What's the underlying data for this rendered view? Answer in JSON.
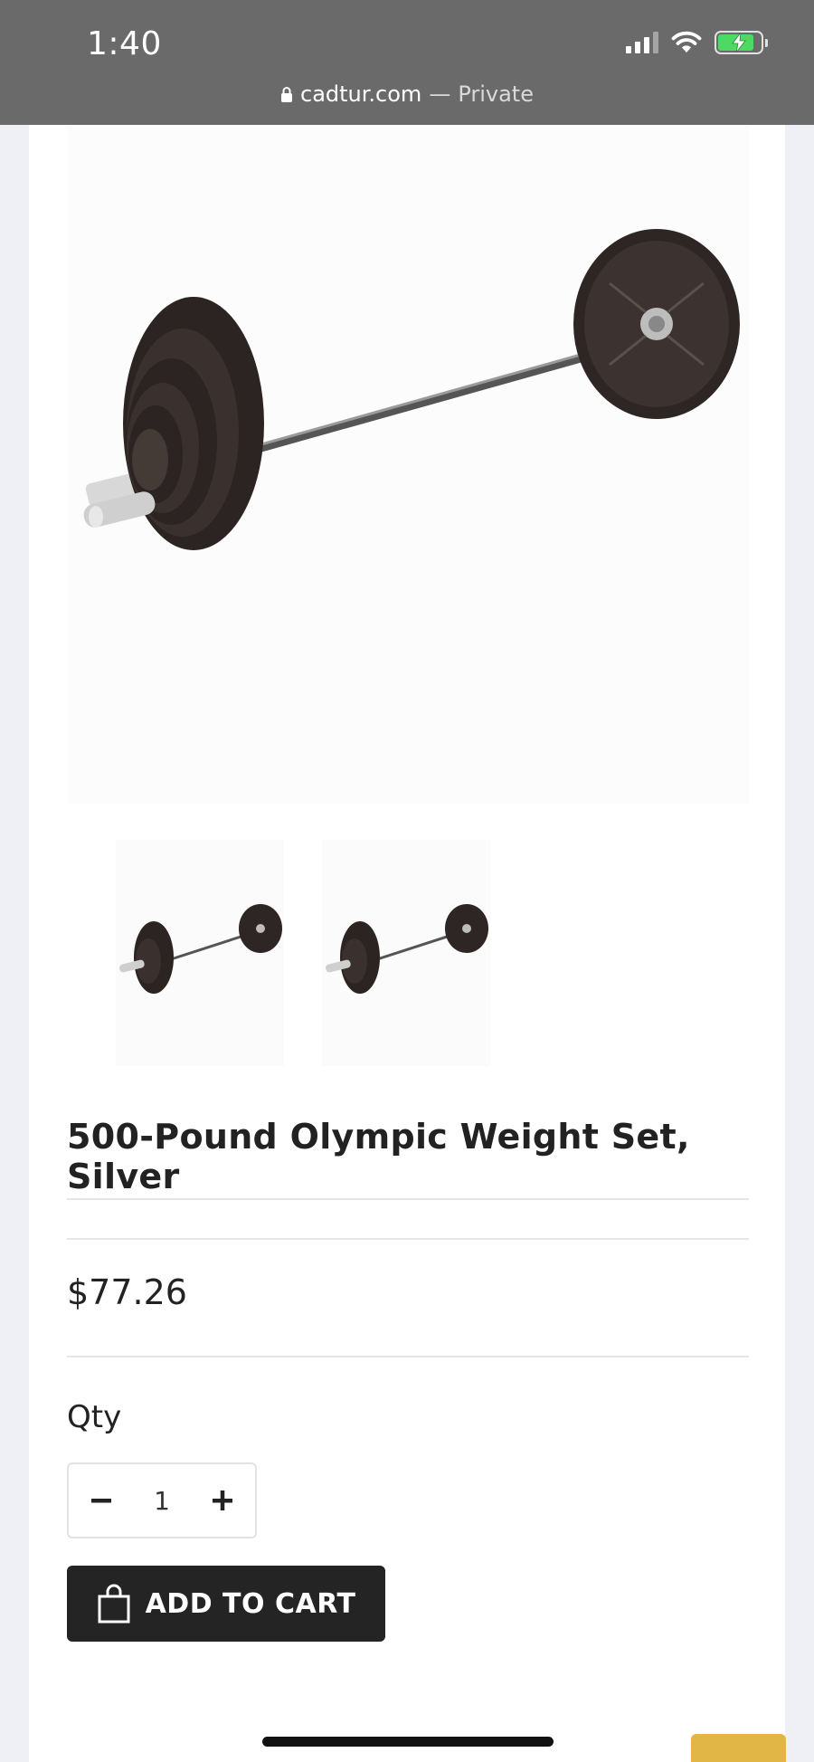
{
  "status_bar": {
    "time": "1:40",
    "icons": [
      "signal-icon",
      "wifi-icon",
      "battery-charging-icon"
    ],
    "battery_level": 0.85,
    "battery_color": "#4cd964"
  },
  "address_bar": {
    "domain": "cadtur.com",
    "separator": "—",
    "mode": "Private",
    "icon": "lock-icon"
  },
  "product": {
    "main_image": "barbell-weight-set-image",
    "thumbnails": [
      "barbell-thumbnail-1",
      "barbell-thumbnail-2"
    ],
    "title": "500-Pound Olympic Weight Set, Silver",
    "price": "$77.26"
  },
  "quantity": {
    "label": "Qty",
    "value": "1",
    "decrement_icon": "minus-icon",
    "increment_icon": "plus-icon"
  },
  "add_to_cart": {
    "label": "ADD TO CART",
    "icon": "shopping-bag-icon",
    "color": "#242424"
  },
  "scroll_to_top": {
    "icon": "chevron-up-icon",
    "color": "#e2b646"
  }
}
